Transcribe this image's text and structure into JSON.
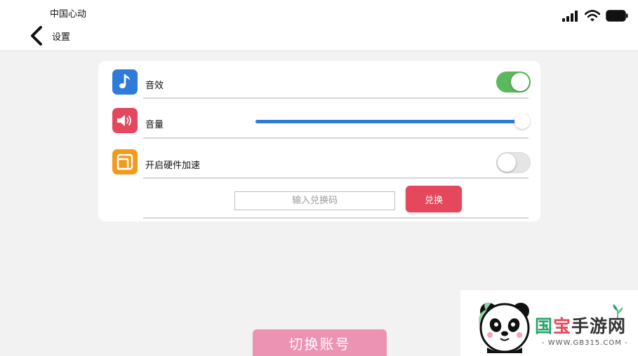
{
  "status_bar": {
    "carrier": "中国心动"
  },
  "nav": {
    "title": "设置"
  },
  "settings": {
    "sound_effects": {
      "label": "音效",
      "enabled": true
    },
    "volume": {
      "label": "音量",
      "level": 1.0
    },
    "hardware_acceleration": {
      "label": "开启硬件加速",
      "enabled": false
    },
    "redeem": {
      "placeholder": "输入兑换码",
      "button_label": "兑换"
    }
  },
  "switch_account": {
    "label": "切换账号"
  },
  "watermark": {
    "name_part1": "国",
    "name_part2": "宝",
    "name_part3": "手游网",
    "url": "- WWW.GB315.COM -"
  },
  "colors": {
    "toggle_on": "#5cb85c",
    "slider_fill": "#2f7bdc",
    "accent_red": "#e5485d",
    "switch_button": "#ec93b3",
    "music_icon": "#2f7bdc",
    "volume_icon": "#e5485d",
    "hw_icon": "#f39a1e"
  }
}
